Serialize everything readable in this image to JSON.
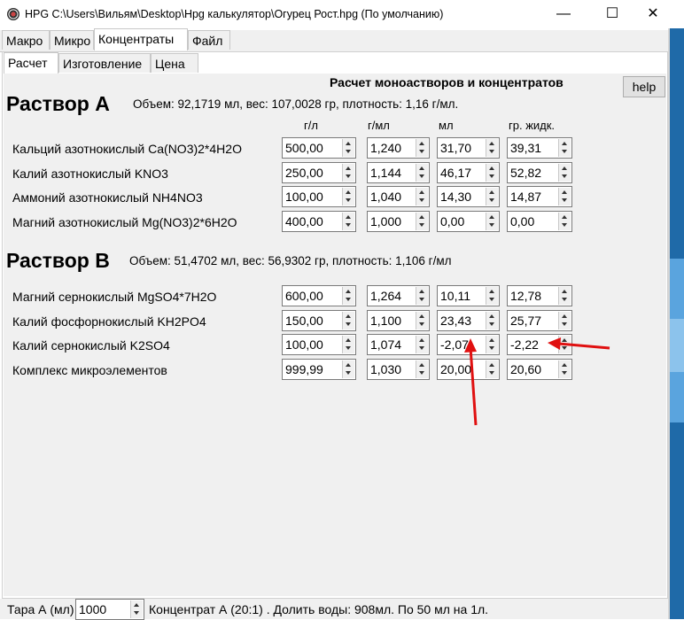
{
  "window": {
    "title": "HPG C:\\Users\\Вильям\\Desktop\\Hpg калькулятор\\Огурец Рост.hpg (По умолчанию)",
    "minimize": "—",
    "maximize": "☐",
    "close": "✕"
  },
  "tabs": [
    "Макро",
    "Микро",
    "Концентраты",
    "Файл"
  ],
  "subtabs": [
    "Расчет",
    "Изготовление",
    "Цена"
  ],
  "heading": "Расчет моноастворов и концентратов",
  "help": "help",
  "solution_a": {
    "title": "Раствор А",
    "summary": "Объем: 92,1719 мл, вес: 107,0028 гр, плотность: 1,16 г/мл.",
    "headers": [
      "г/л",
      "г/мл",
      "мл",
      "гр. жидк."
    ],
    "rows": [
      {
        "label": "Кальций азотнокислый Ca(NO3)2*4H2O",
        "gl": "500,00",
        "gml": "1,240",
        "ml": "31,70",
        "gr": "39,31"
      },
      {
        "label": "Калий азотнокислый KNO3",
        "gl": "250,00",
        "gml": "1,144",
        "ml": "46,17",
        "gr": "52,82"
      },
      {
        "label": "Аммоний азотнокислый NH4NO3",
        "gl": "100,00",
        "gml": "1,040",
        "ml": "14,30",
        "gr": "14,87"
      },
      {
        "label": "Магний азотнокислый Mg(NO3)2*6H2O",
        "gl": "400,00",
        "gml": "1,000",
        "ml": "0,00",
        "gr": "0,00"
      }
    ]
  },
  "solution_b": {
    "title": "Раствор В",
    "summary": "Объем: 51,4702 мл, вес: 56,9302 гр, плотность: 1,106 г/мл",
    "rows": [
      {
        "label": "Магний сернокислый MgSO4*7H2O",
        "gl": "600,00",
        "gml": "1,264",
        "ml": "10,11",
        "gr": "12,78"
      },
      {
        "label": "Калий фосфорнокислый KH2PO4",
        "gl": "150,00",
        "gml": "1,100",
        "ml": "23,43",
        "gr": "25,77"
      },
      {
        "label": "Калий сернокислый K2SO4",
        "gl": "100,00",
        "gml": "1,074",
        "ml": "-2,07",
        "gr": "-2,22"
      },
      {
        "label": "Комплекс микроэлементов",
        "gl": "999,99",
        "gml": "1,030",
        "ml": "20,00",
        "gr": "20,60"
      }
    ]
  },
  "bottom": {
    "tara_label": "Тара А (мл)",
    "tara_value": "1000",
    "info": "Концентрат А (20:1) . Долить воды: 908мл. По 50 мл на 1л."
  },
  "colors": {
    "annotation": "#e01010",
    "desktop": "#1f6aa8"
  }
}
